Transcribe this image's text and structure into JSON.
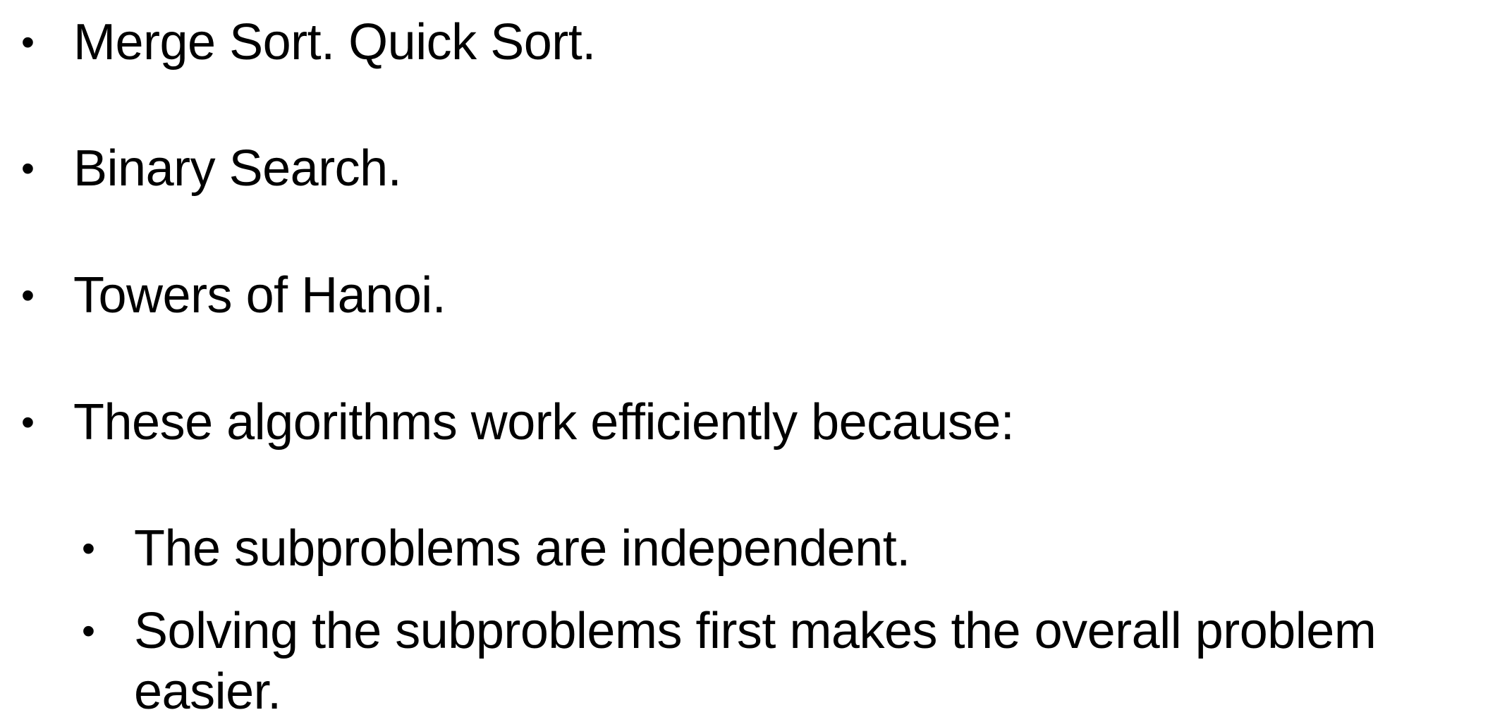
{
  "bullets": [
    "Merge Sort. Quick Sort.",
    "Binary Search.",
    "Towers of Hanoi.",
    "These algorithms work efficiently because:"
  ],
  "sub_bullets": [
    "The subproblems are independent.",
    "Solving the subproblems first makes the overall problem easier."
  ],
  "bullet_glyph": "•"
}
